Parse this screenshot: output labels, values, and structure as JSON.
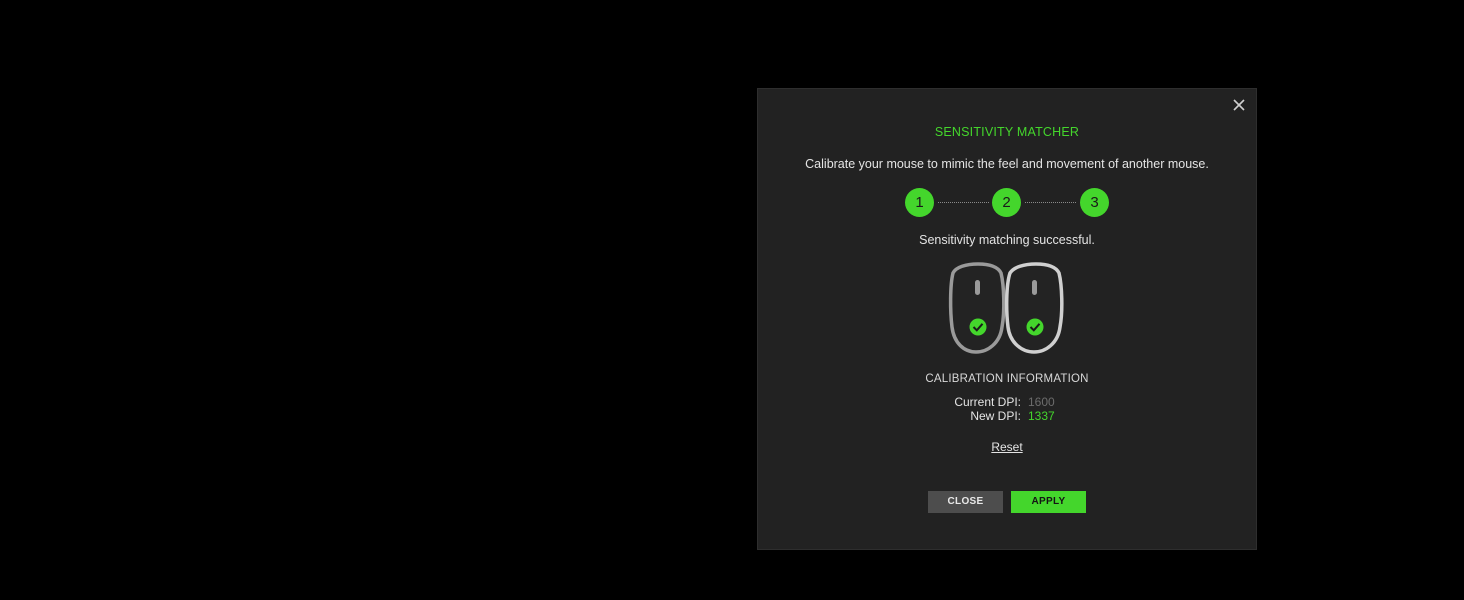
{
  "dialog": {
    "title": "SENSITIVITY MATCHER",
    "subtitle": "Calibrate your mouse to mimic the feel and movement of another mouse.",
    "close_icon": "close-icon",
    "steps": [
      "1",
      "2",
      "3"
    ],
    "status": "Sensitivity matching successful.",
    "illustration_icons": [
      "mouse-icon",
      "mouse-icon",
      "check-icon",
      "check-icon"
    ],
    "calibration": {
      "heading": "CALIBRATION INFORMATION",
      "current_dpi_label": "Current DPI:",
      "current_dpi_value": "1600",
      "new_dpi_label": "New DPI:",
      "new_dpi_value": "1337"
    },
    "reset_label": "Reset",
    "buttons": {
      "close_label": "CLOSE",
      "apply_label": "APPLY"
    }
  },
  "colors": {
    "accent": "#44d62c",
    "background": "#000000",
    "dialog_background": "#222222",
    "close_button": "#4d4d4d",
    "muted_value": "#6c6c6c"
  }
}
